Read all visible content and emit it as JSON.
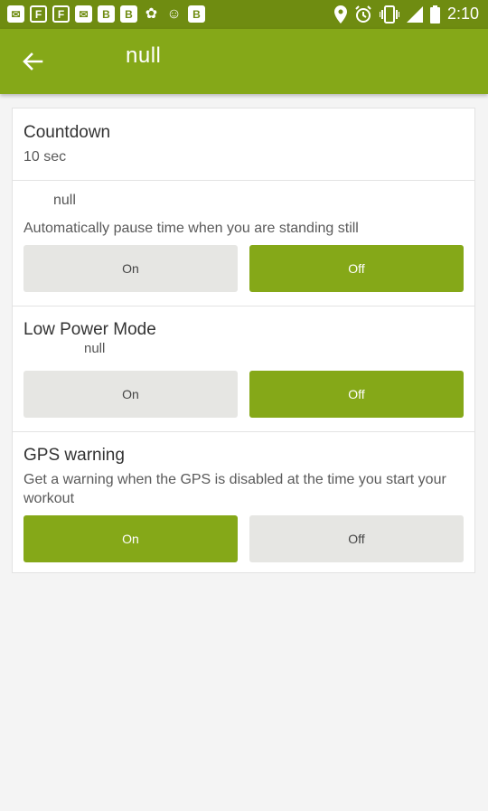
{
  "status_bar": {
    "time": "2:10",
    "left_icons": [
      "mail-icon",
      "flipboard-icon",
      "flipboard-icon",
      "mail-icon",
      "b-icon",
      "b-icon",
      "puzzle-icon",
      "cat-icon",
      "b-icon"
    ],
    "right_icons": [
      "location-icon",
      "alarm-icon",
      "vibrate-icon",
      "signal-icon",
      "battery-icon"
    ]
  },
  "app_bar": {
    "title": "null",
    "background": "#85a818"
  },
  "sections": {
    "countdown": {
      "title": "Countdown",
      "value": "10 sec"
    },
    "autopause": {
      "title": "null",
      "description": "Automatically pause time when you are standing still",
      "on_label": "On",
      "off_label": "Off",
      "selected": "Off"
    },
    "low_power": {
      "title": "Low Power Mode",
      "description": "null",
      "on_label": "On",
      "off_label": "Off",
      "selected": "Off"
    },
    "gps_warning": {
      "title": "GPS warning",
      "description": "Get a warning when the GPS is disabled at the time you start your workout",
      "on_label": "On",
      "off_label": "Off",
      "selected": "On"
    }
  },
  "colors": {
    "accent": "#85a818",
    "status_bar": "#6f8c11",
    "unselected_button": "#e6e6e3"
  }
}
